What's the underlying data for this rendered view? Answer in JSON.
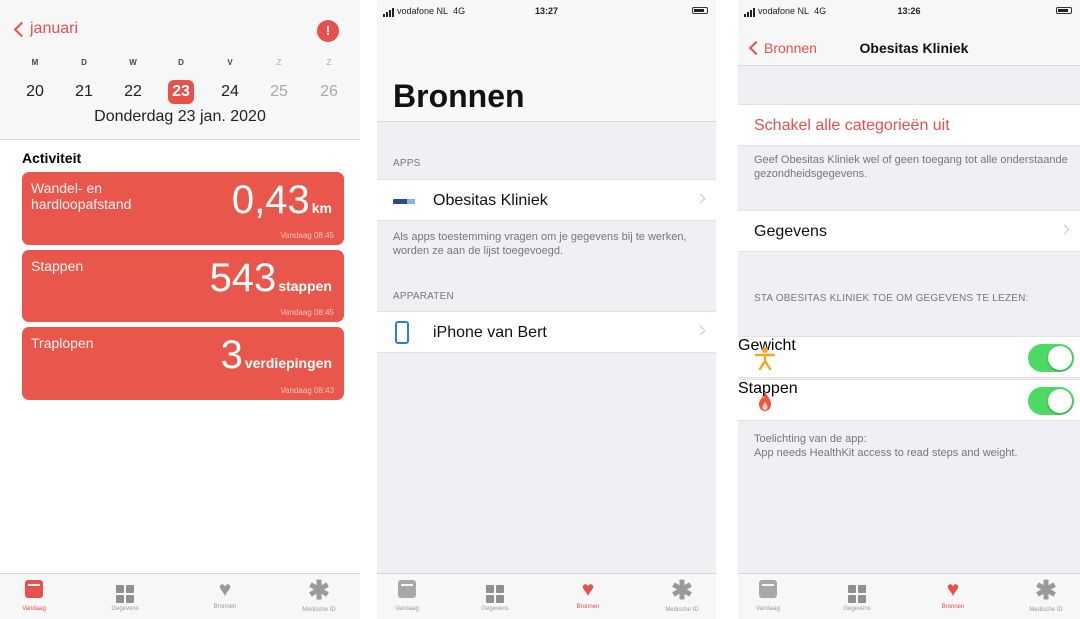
{
  "colors": {
    "accent": "#e8504c",
    "card": "#e9564c",
    "toggle_on": "#4cd964",
    "link_blue": "#2f7de1"
  },
  "today": {
    "back_label": "januari",
    "profile_glyph": "!",
    "weekdays": [
      "M",
      "D",
      "W",
      "D",
      "V",
      "Z",
      "Z"
    ],
    "dates": [
      "20",
      "21",
      "22",
      "23",
      "24",
      "25",
      "26"
    ],
    "selected_date": "23",
    "date_full": "Donderdag 23 jan. 2020",
    "section": "Activiteit",
    "cards": [
      {
        "label": "Wandel- en hardloopafstand",
        "value": "0,43",
        "unit": "km",
        "time": "Vandaag 08:45"
      },
      {
        "label": "Stappen",
        "value": "543",
        "unit": "stappen",
        "time": "Vandaag 08:45"
      },
      {
        "label": "Traplopen",
        "value": "3",
        "unit": "verdiepingen",
        "time": "Vandaag 08:43"
      }
    ]
  },
  "tabs": {
    "labels": [
      "Vandaag",
      "Gegevens",
      "Bronnen",
      "Medische ID"
    ],
    "icons": [
      "today-icon",
      "grid-icon",
      "heart-icon",
      "asterisk-icon"
    ]
  },
  "bronnen": {
    "status": {
      "carrier": "vodafone NL",
      "network": "4G",
      "time": "13:27"
    },
    "title": "Bronnen",
    "apps_header": "APPS",
    "app_name": "Obesitas Kliniek",
    "apps_note": "Als apps toestemming vragen om je gegevens bij te werken, worden ze aan de lijst toegevoegd.",
    "devices_header": "APPARATEN",
    "device_name": "iPhone van Bert"
  },
  "detail": {
    "status": {
      "carrier": "vodafone NL",
      "network": "4G",
      "time": "13:26"
    },
    "back_label": "Bronnen",
    "title": "Obesitas Kliniek",
    "disable_all": "Schakel alle categorieën uit",
    "access_note": "Geef Obesitas Kliniek wel of geen toegang tot alle onderstaande gezondheidsgegevens.",
    "data_row": "Gegevens",
    "read_header": "STA OBESITAS KLINIEK TOE OM GEGEVENS TE LEZEN:",
    "permissions": [
      {
        "label": "Gewicht",
        "icon": "person-icon",
        "enabled": true
      },
      {
        "label": "Stappen",
        "icon": "flame-icon",
        "enabled": true
      }
    ],
    "app_desc_title": "Toelichting van de app:",
    "app_desc": "App needs HealthKit access to read steps and weight."
  }
}
